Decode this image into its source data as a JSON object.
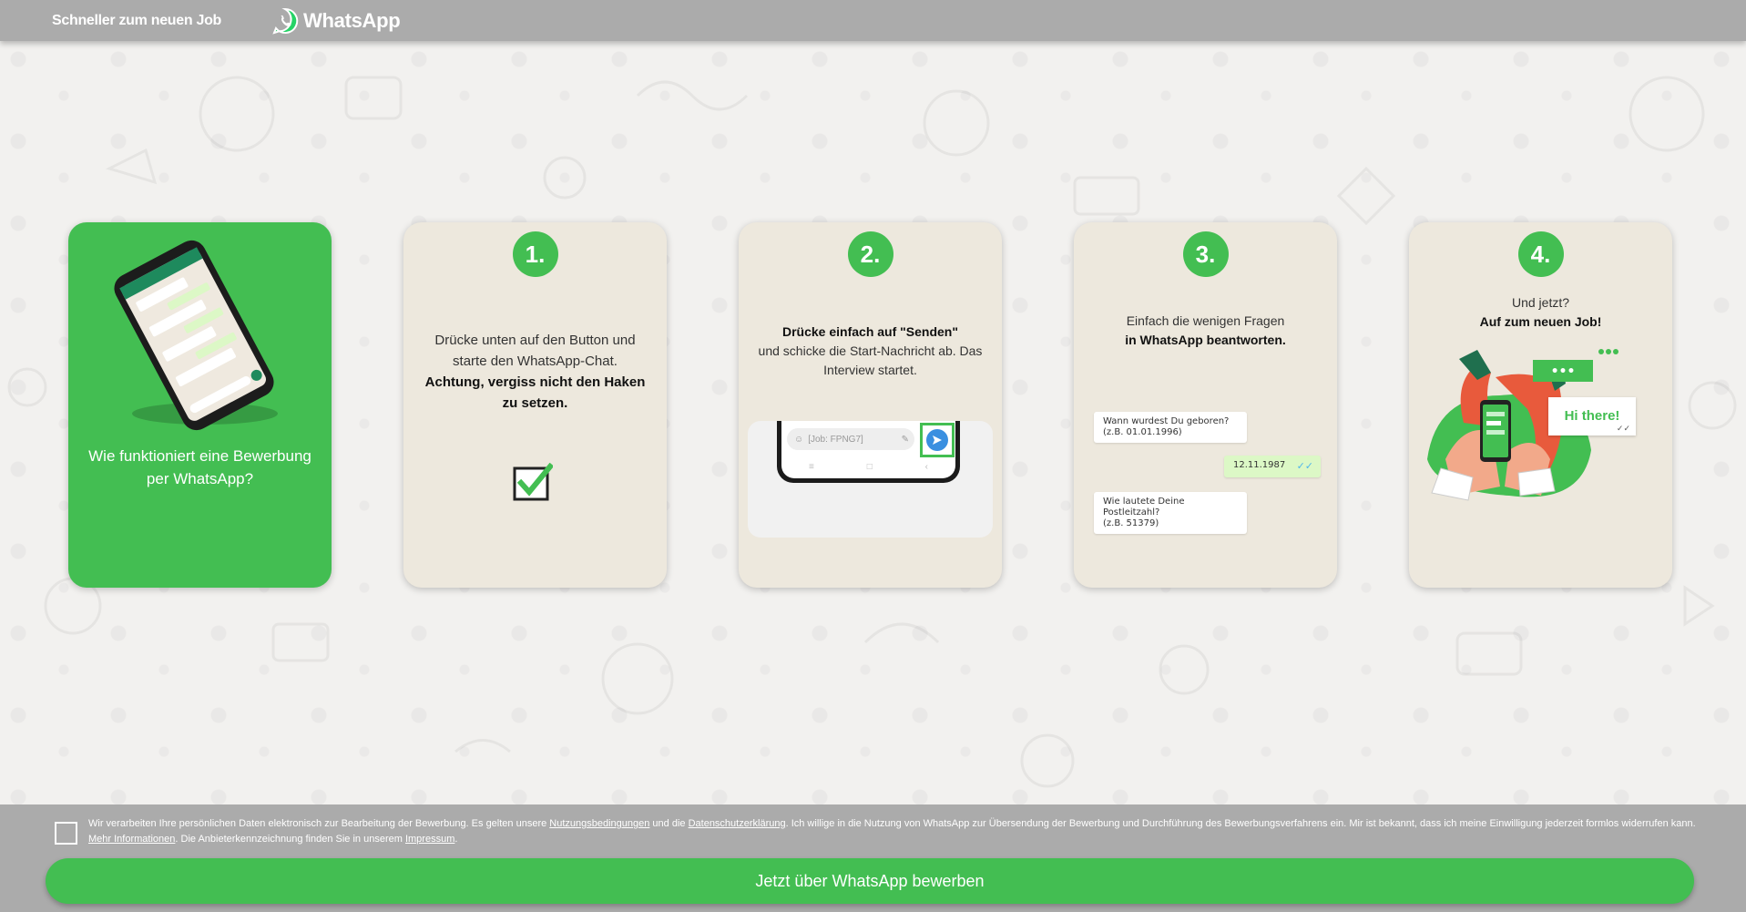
{
  "header": {
    "tagline": "Schneller zum neuen Job",
    "logo_text": "WhatsApp"
  },
  "intro_card": {
    "caption": "Wie funktioniert eine Bewerbung per WhatsApp?"
  },
  "steps": [
    {
      "number": "1.",
      "text_plain": "Drücke unten auf den Button und starte den WhatsApp-Chat.",
      "text_bold": "Achtung, vergiss nicht den Haken zu setzen."
    },
    {
      "number": "2.",
      "text_bold": "Drücke einfach auf \"Senden\"",
      "text_plain": "und schicke die Start-Nachricht ab. Das Interview startet.",
      "input_placeholder": "[Job: FPNG7]"
    },
    {
      "number": "3.",
      "text_plain": "Einfach die wenigen Fragen",
      "text_bold": "in WhatsApp beantworten.",
      "chat": {
        "q1_line1": "Wann wurdest Du geboren?",
        "q1_line2": "(z.B. 01.01.1996)",
        "a1": "12.11.1987",
        "q2_line1": "Wie lautete Deine Postleitzahl?",
        "q2_line2": "(z.B. 51379)"
      }
    },
    {
      "number": "4.",
      "text_plain": "Und jetzt?",
      "text_bold": "Auf zum neuen Job!",
      "bubble_text": "Hi there!"
    }
  ],
  "footer": {
    "consent_part1": "Wir verarbeiten Ihre persönlichen Daten elektronisch zur Bearbeitung der Bewerbung. Es gelten unsere ",
    "link_terms": "Nutzungsbedingungen",
    "consent_part2": " und die ",
    "link_privacy": "Datenschutzerklärung",
    "consent_part3": ". Ich willige in die Nutzung von WhatsApp zur Übersendung der Bewerbung und Durchführung des Bewerbungsverfahrens ein. Mir ist bekannt, dass ich meine Einwilligung jederzeit formlos widerrufen kann. ",
    "link_more": "Mehr Informationen",
    "consent_part4": ". Die Anbieterkennzeichnung finden Sie in unserem ",
    "link_imprint": "Impressum",
    "consent_part5": ".",
    "cta_label": "Jetzt über WhatsApp bewerben"
  },
  "colors": {
    "brand_green": "#43be52",
    "header_gray": "#ababab",
    "card_beige": "#ede8dd"
  }
}
